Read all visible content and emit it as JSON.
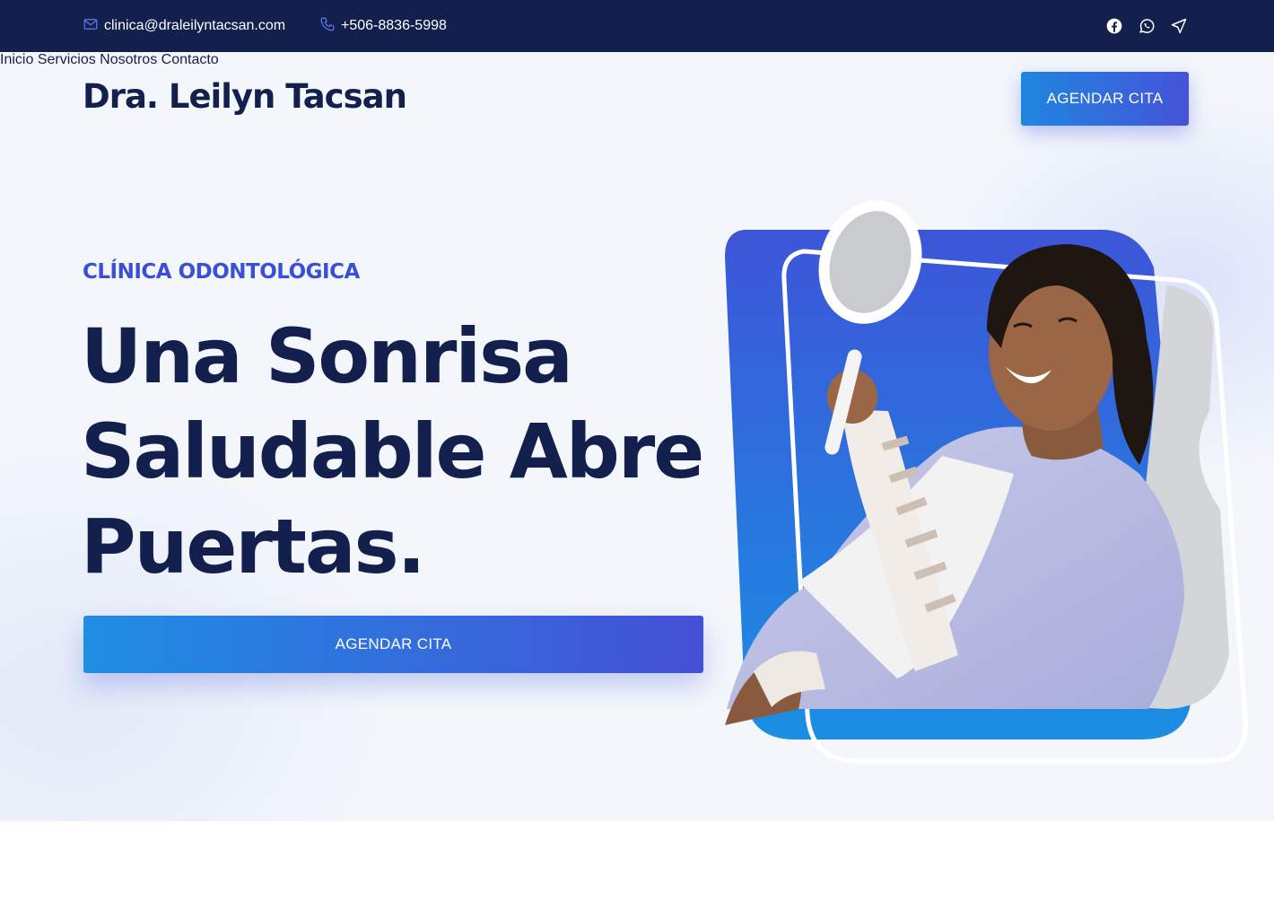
{
  "topbar": {
    "email": "clinica@draleilyntacsan.com",
    "phone": "+506-8836-5998",
    "socials": [
      "facebook-icon",
      "whatsapp-icon",
      "location-arrow-icon"
    ]
  },
  "header": {
    "brand": "Dra. Leilyn Tacsan",
    "nav": [
      "Inicio",
      "Servicios",
      "Nosotros",
      "Contacto"
    ],
    "cta": "AGENDAR CITA"
  },
  "hero": {
    "eyebrow": "CLÍNICA ODONTOLÓGICA",
    "headline_lines": [
      "Una Sonrisa",
      "Saludable Abre",
      "Puertas."
    ],
    "cta": "AGENDAR CITA",
    "image": "smiling-patient-holding-mirror"
  },
  "colors": {
    "navy": "#13204d",
    "accent_blue": "#3b4fd6",
    "gradient_start": "#1f8ee3",
    "gradient_end": "#4550d6",
    "hero_bg": "#f3f6fb"
  }
}
